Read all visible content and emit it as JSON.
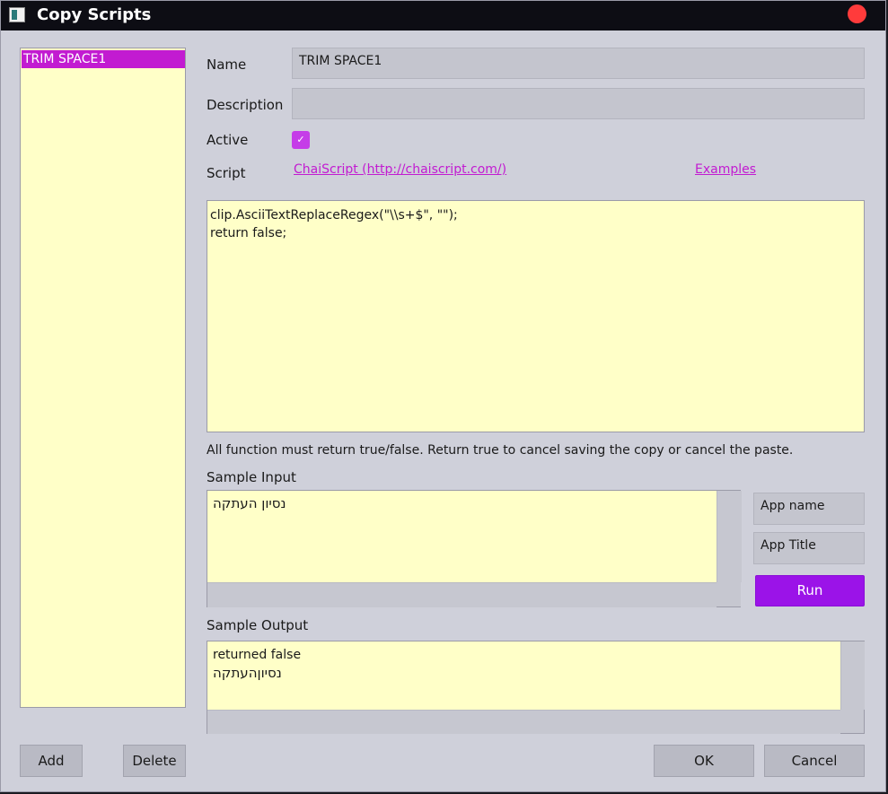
{
  "window": {
    "title": "Copy Scripts",
    "icon": "app-window-icon",
    "close_color": "#ff3b3b"
  },
  "scripts_list": {
    "items": [
      "TRIM SPACE1"
    ]
  },
  "form": {
    "name_label": "Name",
    "name_value": "TRIM SPACE1",
    "description_label": "Description",
    "description_value": "",
    "active_label": "Active",
    "active_checked": true,
    "checkmark": "✓",
    "script_label": "Script",
    "chaiscript_link": "ChaiScript (http://chaiscript.com/)",
    "examples_link": "Examples",
    "script_lines": [
      "clip.AsciiTextReplaceRegex(\"\\\\s+$\", \"\");",
      "return false;"
    ],
    "hint": "All function must return true/false.  Return true to cancel saving the copy or cancel the paste.",
    "sample_input_label": "Sample Input",
    "sample_input_text": "נסיון העתקה",
    "app_name_placeholder": "App name",
    "app_title_placeholder": "App Title",
    "run_label": "Run",
    "sample_output_label": "Sample Output",
    "sample_output_lines": [
      "returned false",
      "נסיוןהעתקה"
    ]
  },
  "buttons": {
    "add": "Add",
    "delete": "Delete",
    "ok": "OK",
    "cancel": "Cancel"
  },
  "colors": {
    "accent": "#c21bd1",
    "run": "#9b13e8",
    "editor_bg": "#ffffc8",
    "window_bg": "#cfd0da"
  }
}
